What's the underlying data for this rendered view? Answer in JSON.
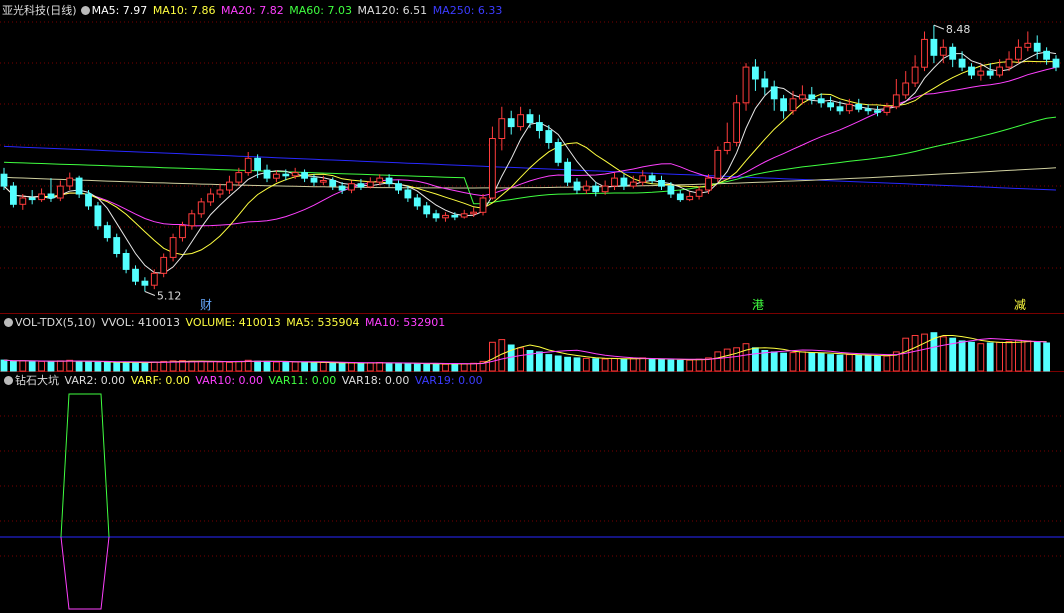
{
  "main_legend": {
    "stock": "亚光科技(日线)",
    "ma5": "MA5: 7.97",
    "ma10": "MA10: 7.86",
    "ma20": "MA20: 7.82",
    "ma60": "MA60: 7.03",
    "ma120": "MA120: 6.51",
    "ma250": "MA250: 6.33"
  },
  "vol_legend": {
    "name": "VOL-TDX(5,10)",
    "vvol": "VVOL: 410013",
    "volume": "VOLUME: 410013",
    "ma5": "MA5: 535904",
    "ma10": "MA10: 532901"
  },
  "ind_legend": {
    "name": "钻石大坑",
    "var2": "VAR2: 0.00",
    "varf": "VARF: 0.00",
    "var10": "VAR10: 0.00",
    "var11": "VAR11: 0.00",
    "var18": "VAR18: 0.00",
    "var19": "VAR19: 0.00"
  },
  "markers": {
    "cai": "财",
    "gang": "港",
    "jian": "减"
  },
  "annotations": {
    "high": "8.48",
    "low": "5.12"
  },
  "colors": {
    "up": "#ff3c3c",
    "down": "#54ffff",
    "ma5": "#e8e8e8",
    "ma10": "#ffff40",
    "ma20": "#ff40ff",
    "ma60": "#40ff40",
    "ma120": "#d0d0a0",
    "ma250": "#2828ff",
    "vol_ma5": "#ffff40",
    "vol_ma10": "#ff40ff"
  },
  "chart_data": {
    "type": "candlestick",
    "price_range": [
      4.95,
      8.62
    ],
    "high": 8.48,
    "low": 5.12,
    "candles": [
      [
        6.6,
        6.45,
        6.68,
        6.4
      ],
      [
        6.45,
        6.22,
        6.5,
        6.18
      ],
      [
        6.22,
        6.3,
        6.35,
        6.15
      ],
      [
        6.3,
        6.28,
        6.4,
        6.22
      ],
      [
        6.28,
        6.35,
        6.42,
        6.25
      ],
      [
        6.35,
        6.3,
        6.55,
        6.25
      ],
      [
        6.3,
        6.45,
        6.52,
        6.26
      ],
      [
        6.45,
        6.55,
        6.62,
        6.4
      ],
      [
        6.55,
        6.35,
        6.58,
        6.3
      ],
      [
        6.35,
        6.2,
        6.4,
        6.15
      ],
      [
        6.2,
        5.95,
        6.25,
        5.9
      ],
      [
        5.95,
        5.8,
        6.0,
        5.75
      ],
      [
        5.8,
        5.6,
        5.85,
        5.55
      ],
      [
        5.6,
        5.4,
        5.65,
        5.35
      ],
      [
        5.4,
        5.25,
        5.45,
        5.2
      ],
      [
        5.25,
        5.2,
        5.3,
        5.12
      ],
      [
        5.2,
        5.35,
        5.4,
        5.15
      ],
      [
        5.35,
        5.55,
        5.6,
        5.3
      ],
      [
        5.55,
        5.8,
        5.85,
        5.5
      ],
      [
        5.8,
        5.95,
        6.0,
        5.75
      ],
      [
        5.95,
        6.1,
        6.15,
        5.9
      ],
      [
        6.1,
        6.25,
        6.3,
        6.05
      ],
      [
        6.25,
        6.35,
        6.42,
        6.2
      ],
      [
        6.35,
        6.4,
        6.48,
        6.3
      ],
      [
        6.4,
        6.5,
        6.58,
        6.35
      ],
      [
        6.5,
        6.62,
        6.68,
        6.45
      ],
      [
        6.62,
        6.8,
        6.88,
        6.58
      ],
      [
        6.8,
        6.65,
        6.85,
        6.55
      ],
      [
        6.65,
        6.55,
        6.72,
        6.5
      ],
      [
        6.55,
        6.6,
        6.65,
        6.5
      ],
      [
        6.6,
        6.58,
        6.66,
        6.52
      ],
      [
        6.58,
        6.62,
        6.68,
        6.54
      ],
      [
        6.62,
        6.55,
        6.66,
        6.5
      ],
      [
        6.55,
        6.5,
        6.6,
        6.45
      ],
      [
        6.5,
        6.52,
        6.58,
        6.46
      ],
      [
        6.52,
        6.45,
        6.56,
        6.4
      ],
      [
        6.45,
        6.4,
        6.5,
        6.35
      ],
      [
        6.4,
        6.48,
        6.52,
        6.36
      ],
      [
        6.48,
        6.44,
        6.54,
        6.4
      ],
      [
        6.44,
        6.5,
        6.56,
        6.42
      ],
      [
        6.5,
        6.55,
        6.6,
        6.46
      ],
      [
        6.55,
        6.48,
        6.6,
        6.44
      ],
      [
        6.48,
        6.4,
        6.52,
        6.35
      ],
      [
        6.4,
        6.3,
        6.45,
        6.25
      ],
      [
        6.3,
        6.2,
        6.35,
        6.15
      ],
      [
        6.2,
        6.1,
        6.25,
        6.05
      ],
      [
        6.1,
        6.05,
        6.15,
        6.0
      ],
      [
        6.05,
        6.08,
        6.12,
        6.0
      ],
      [
        6.08,
        6.06,
        6.12,
        6.02
      ],
      [
        6.06,
        6.1,
        6.15,
        6.04
      ],
      [
        6.1,
        6.12,
        6.18,
        6.06
      ],
      [
        6.12,
        6.3,
        6.35,
        6.08
      ],
      [
        6.3,
        7.05,
        7.2,
        6.28
      ],
      [
        7.05,
        7.3,
        7.45,
        6.9
      ],
      [
        7.3,
        7.2,
        7.4,
        7.1
      ],
      [
        7.2,
        7.35,
        7.45,
        7.15
      ],
      [
        7.35,
        7.25,
        7.42,
        7.18
      ],
      [
        7.25,
        7.15,
        7.35,
        7.05
      ],
      [
        7.15,
        7.0,
        7.22,
        6.92
      ],
      [
        7.0,
        6.75,
        7.05,
        6.7
      ],
      [
        6.75,
        6.5,
        6.8,
        6.45
      ],
      [
        6.5,
        6.4,
        6.55,
        6.35
      ],
      [
        6.4,
        6.45,
        6.52,
        6.35
      ],
      [
        6.45,
        6.38,
        6.5,
        6.32
      ],
      [
        6.38,
        6.45,
        6.52,
        6.34
      ],
      [
        6.45,
        6.55,
        6.62,
        6.4
      ],
      [
        6.55,
        6.45,
        6.6,
        6.4
      ],
      [
        6.45,
        6.5,
        6.58,
        6.42
      ],
      [
        6.5,
        6.58,
        6.65,
        6.45
      ],
      [
        6.58,
        6.52,
        6.62,
        6.48
      ],
      [
        6.52,
        6.45,
        6.58,
        6.4
      ],
      [
        6.45,
        6.35,
        6.5,
        6.3
      ],
      [
        6.35,
        6.28,
        6.4,
        6.25
      ],
      [
        6.28,
        6.32,
        6.38,
        6.26
      ],
      [
        6.32,
        6.4,
        6.45,
        6.28
      ],
      [
        6.4,
        6.55,
        6.6,
        6.35
      ],
      [
        6.55,
        6.9,
        6.95,
        6.5
      ],
      [
        6.9,
        7.0,
        7.25,
        6.85
      ],
      [
        7.0,
        7.5,
        7.6,
        6.95
      ],
      [
        7.5,
        7.95,
        8.0,
        7.4
      ],
      [
        7.95,
        7.8,
        8.05,
        7.65
      ],
      [
        7.8,
        7.7,
        7.9,
        7.6
      ],
      [
        7.7,
        7.55,
        7.78,
        7.4
      ],
      [
        7.55,
        7.4,
        7.6,
        7.3
      ],
      [
        7.4,
        7.55,
        7.65,
        7.35
      ],
      [
        7.55,
        7.6,
        7.72,
        7.48
      ],
      [
        7.6,
        7.55,
        7.7,
        7.48
      ],
      [
        7.55,
        7.5,
        7.62,
        7.44
      ],
      [
        7.5,
        7.45,
        7.58,
        7.4
      ],
      [
        7.45,
        7.4,
        7.52,
        7.35
      ],
      [
        7.4,
        7.48,
        7.55,
        7.36
      ],
      [
        7.48,
        7.42,
        7.55,
        7.38
      ],
      [
        7.42,
        7.4,
        7.48,
        7.35
      ],
      [
        7.4,
        7.38,
        7.46,
        7.33
      ],
      [
        7.38,
        7.45,
        7.5,
        7.34
      ],
      [
        7.45,
        7.6,
        7.8,
        7.42
      ],
      [
        7.6,
        7.75,
        7.9,
        7.55
      ],
      [
        7.75,
        7.95,
        8.1,
        7.7
      ],
      [
        7.95,
        8.3,
        8.4,
        7.9
      ],
      [
        8.3,
        8.1,
        8.48,
        8.0
      ],
      [
        8.1,
        8.2,
        8.3,
        8.0
      ],
      [
        8.2,
        8.05,
        8.25,
        7.95
      ],
      [
        8.05,
        7.95,
        8.15,
        7.9
      ],
      [
        7.95,
        7.85,
        8.0,
        7.8
      ],
      [
        7.85,
        7.9,
        7.98,
        7.78
      ],
      [
        7.9,
        7.85,
        8.0,
        7.8
      ],
      [
        7.85,
        7.95,
        8.05,
        7.82
      ],
      [
        7.95,
        8.05,
        8.15,
        7.9
      ],
      [
        8.05,
        8.2,
        8.3,
        8.0
      ],
      [
        8.2,
        8.25,
        8.4,
        8.15
      ],
      [
        8.25,
        8.15,
        8.35,
        8.05
      ],
      [
        8.15,
        8.05,
        8.2,
        7.98
      ],
      [
        8.05,
        7.95,
        8.1,
        7.9
      ]
    ],
    "volume": [
      80,
      70,
      75,
      72,
      70,
      68,
      74,
      78,
      70,
      66,
      64,
      62,
      60,
      62,
      65,
      60,
      66,
      70,
      74,
      76,
      72,
      70,
      68,
      66,
      64,
      70,
      78,
      72,
      70,
      66,
      64,
      66,
      62,
      60,
      62,
      58,
      56,
      60,
      58,
      60,
      62,
      58,
      56,
      54,
      52,
      50,
      52,
      50,
      54,
      52,
      56,
      70,
      210,
      230,
      190,
      170,
      150,
      140,
      120,
      110,
      100,
      96,
      92,
      90,
      88,
      92,
      86,
      90,
      96,
      88,
      84,
      80,
      78,
      80,
      86,
      96,
      140,
      160,
      170,
      200,
      170,
      150,
      140,
      130,
      135,
      140,
      132,
      128,
      120,
      116,
      120,
      114,
      110,
      108,
      110,
      140,
      240,
      260,
      270,
      280,
      250,
      240,
      220,
      210,
      200,
      205,
      210,
      215,
      225,
      220,
      210,
      205
    ]
  }
}
